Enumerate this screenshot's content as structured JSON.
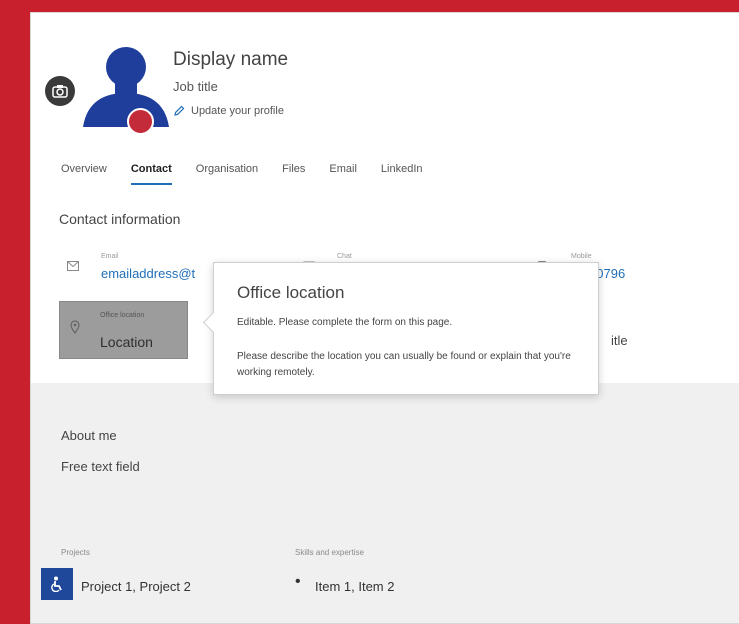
{
  "profile": {
    "display_name": "Display name",
    "job_title": "Job title",
    "update_link": "Update your profile"
  },
  "tabs": [
    {
      "label": "Overview",
      "active": false
    },
    {
      "label": "Contact",
      "active": true
    },
    {
      "label": "Organisation",
      "active": false
    },
    {
      "label": "Files",
      "active": false
    },
    {
      "label": "Email",
      "active": false
    },
    {
      "label": "LinkedIn",
      "active": false
    }
  ],
  "contact": {
    "section_title": "Contact information",
    "email": {
      "label": "Email",
      "value": "emailaddress@t"
    },
    "chat": {
      "label": "Chat"
    },
    "mobile": {
      "label": "Mobile",
      "value": "0 900796"
    },
    "office": {
      "label": "Office location",
      "value": "Location"
    },
    "partial_value": "itle"
  },
  "tooltip": {
    "title": "Office location",
    "line1": "Editable. Please complete the form on this page.",
    "line2": "Please describe the location you can usually be found or explain that you're working remotely."
  },
  "about": {
    "label": "About me",
    "value": "Free text field"
  },
  "projects": {
    "label": "Projects",
    "value": "Project 1, Project 2"
  },
  "skills": {
    "label": "Skills and expertise",
    "value": "Item 1, Item 2"
  },
  "colors": {
    "background": "#c8202c",
    "accent": "#1f6fb8",
    "avatar": "#1f3d9a",
    "presence": "#c42b3a"
  },
  "icons": [
    "camera-icon",
    "pencil-icon",
    "email-icon",
    "chat-icon",
    "phone-icon",
    "location-pin-icon",
    "accessibility-icon"
  ]
}
